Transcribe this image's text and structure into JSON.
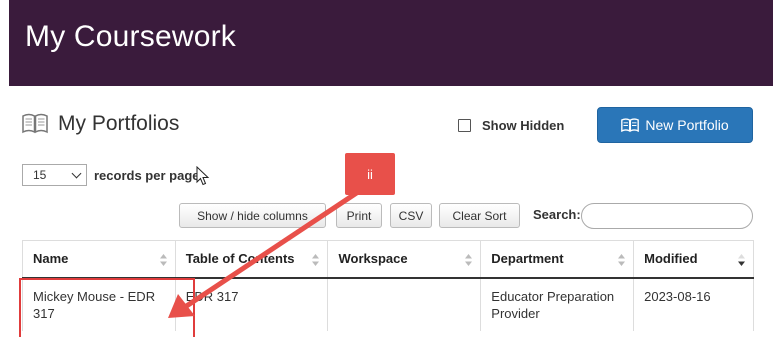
{
  "header": {
    "title": "My Coursework"
  },
  "portfolios": {
    "title": "My Portfolios",
    "show_hidden_label": "Show Hidden",
    "new_button_label": "New Portfolio"
  },
  "records": {
    "selected": "15",
    "label": "records per page"
  },
  "toolbar": {
    "columns_label": "Show / hide columns",
    "print_label": "Print",
    "csv_label": "CSV",
    "clear_sort_label": "Clear Sort",
    "search_label": "Search:",
    "search_value": ""
  },
  "table": {
    "headers": [
      "Name",
      "Table of Contents",
      "Workspace",
      "Department",
      "Modified"
    ],
    "rows": [
      {
        "name": "Mickey Mouse - EDR 317",
        "toc": "EDR 317",
        "workspace": "",
        "department": "Educator Preparation Provider",
        "modified": "2023-08-16"
      }
    ]
  },
  "annotation": {
    "tag": "ii",
    "color": "#e8504a"
  },
  "colors": {
    "header_bg": "#3a1b3c",
    "primary_button": "#2a76b8"
  }
}
